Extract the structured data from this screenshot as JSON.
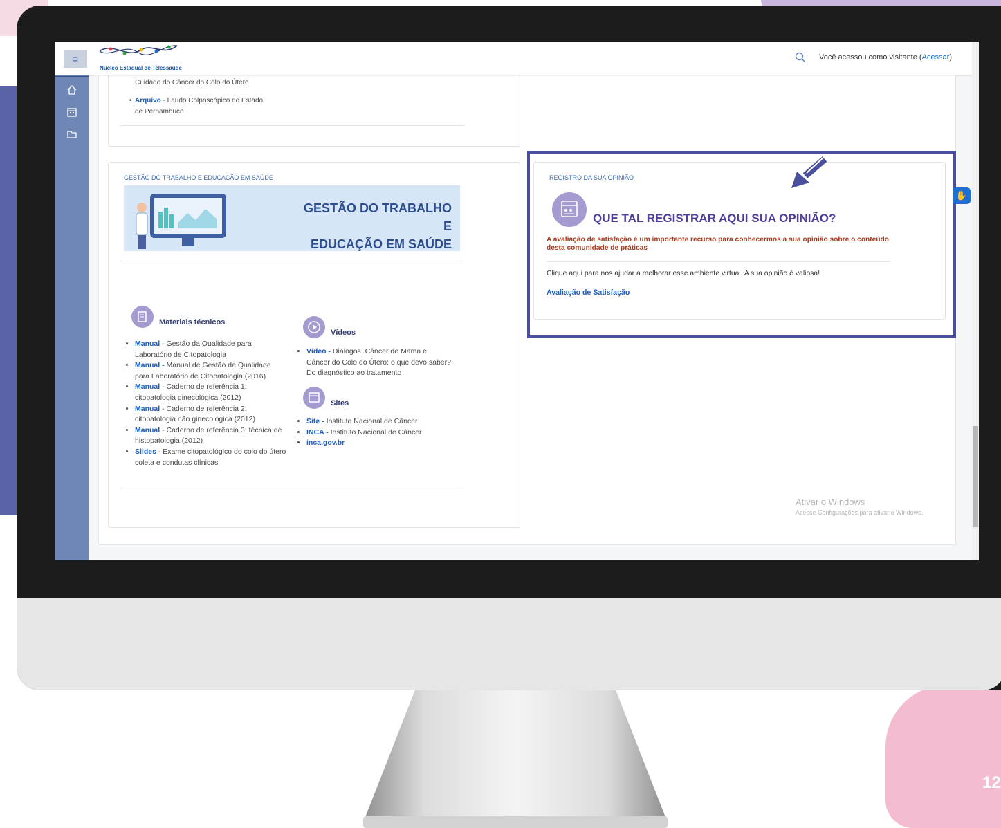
{
  "topbar": {
    "menu_icon": "hamburger-icon",
    "logo_text": "Núcleo Estadual de Telessaúde",
    "search_icon": "search-icon",
    "login_prefix": "Você acessou como visitante (",
    "login_link": "Acessar",
    "login_suffix": ")"
  },
  "sidebar": {
    "icons": [
      "home-icon",
      "calendar-icon",
      "folder-icon"
    ]
  },
  "top_card": {
    "line1": "Cuidado do Câncer do Colo do Útero",
    "item_key": "Arquivo",
    "item_rest_1": " - Laudo Colposcópico do Estado",
    "item_rest_2": "de Pernambuco"
  },
  "gestao_card": {
    "title": "GESTÃO DO TRABALHO E EDUCAÇÃO EM SAÚDE",
    "banner_line1": "GESTÃO DO TRABALHO E",
    "banner_line2": "EDUCAÇÃO EM SAÚDE",
    "materiais": {
      "title": "Materiais técnicos",
      "items": [
        {
          "key": "Manual -",
          "text": " Gestão da Qualidade para Laboratório de Citopatologia"
        },
        {
          "key": "Manual -",
          "text": " Manual de Gestão da Qualidade para Laboratório de Citopatologia (2016)"
        },
        {
          "key": "Manual",
          "text": " - Caderno de referência 1: citopatologia ginecológica (2012)"
        },
        {
          "key": "Manual",
          "text": " - Caderno de referência 2: citopatologia não ginecológica (2012)"
        },
        {
          "key": "Manual",
          "text": " - Caderno de referência 3: técnica de histopatologia (2012)"
        },
        {
          "key": "Slides",
          "text": " - Exame citopatológico do colo do útero coleta e condutas clínicas"
        }
      ]
    },
    "videos": {
      "title": "Vídeos",
      "items": [
        {
          "key": "Vídeo -",
          "text": " Diálogos: Câncer de Mama e Câncer do Colo do Útero: o que devo saber? Do diagnóstico ao tratamento"
        }
      ]
    },
    "sites": {
      "title": "Sites",
      "items": [
        {
          "key": "Site -",
          "text": " Instituto Nacional de Câncer"
        },
        {
          "key": "INCA -",
          "text": " Instituto Nacional de Câncer"
        },
        {
          "key": "inca.gov.br",
          "text": ""
        }
      ]
    }
  },
  "opiniao_card": {
    "title": "REGISTRO DA SUA OPINIÃO",
    "heading": "QUE TAL REGISTRAR AQUI SUA OPINIÃO?",
    "description": "A avaliação de satisfação é um importante recurso para conhecermos a sua opinião sobre o conteúdo desta comunidade de práticas",
    "text": "Clique aqui para nos ajudar a melhorar esse ambiente virtual. A sua opinião é valiosa!",
    "link": "Avaliação de Satisfação"
  },
  "windows_watermark": {
    "line1": "Ativar o Windows",
    "line2": "Acesse Configurações para ativar o Windows."
  },
  "page_number": "12",
  "colors": {
    "highlight_border": "#4a4f9e",
    "link": "#1d5fc0",
    "heading": "#4f3c9b",
    "desc": "#a83d1f"
  }
}
